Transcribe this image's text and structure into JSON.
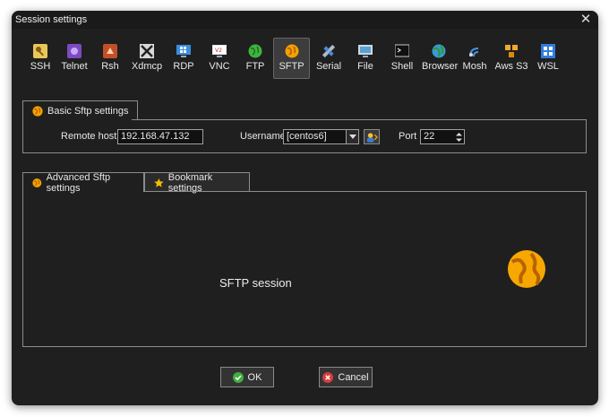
{
  "window": {
    "title": "Session settings"
  },
  "toolbar": {
    "items": [
      {
        "id": "ssh",
        "label": "SSH",
        "icon": "key-icon"
      },
      {
        "id": "telnet",
        "label": "Telnet",
        "icon": "telnet-icon"
      },
      {
        "id": "rsh",
        "label": "Rsh",
        "icon": "rsh-icon"
      },
      {
        "id": "xdmcp",
        "label": "Xdmcp",
        "icon": "x-logo-icon"
      },
      {
        "id": "rdp",
        "label": "RDP",
        "icon": "windows-monitor-icon"
      },
      {
        "id": "vnc",
        "label": "VNC",
        "icon": "vnc-monitor-icon"
      },
      {
        "id": "ftp",
        "label": "FTP",
        "icon": "green-globe-icon"
      },
      {
        "id": "sftp",
        "label": "SFTP",
        "icon": "orange-globe-icon",
        "active": true
      },
      {
        "id": "serial",
        "label": "Serial",
        "icon": "satellite-icon"
      },
      {
        "id": "file",
        "label": "File",
        "icon": "monitor-icon"
      },
      {
        "id": "shell",
        "label": "Shell",
        "icon": "terminal-icon"
      },
      {
        "id": "browser",
        "label": "Browser",
        "icon": "globe-icon"
      },
      {
        "id": "mosh",
        "label": "Mosh",
        "icon": "antenna-icon"
      },
      {
        "id": "awss3",
        "label": "Aws S3",
        "icon": "cubes-icon"
      },
      {
        "id": "wsl",
        "label": "WSL",
        "icon": "windows-logo-icon"
      }
    ]
  },
  "basic": {
    "tab_label": "Basic Sftp settings",
    "remote_host_label": "Remote host *",
    "remote_host_value": "192.168.47.132",
    "username_label": "Username",
    "username_value": "[centos6]",
    "port_label": "Port",
    "port_value": "22"
  },
  "advanced": {
    "tabs": [
      {
        "label": "Advanced Sftp settings",
        "icon": "orange-globe-icon",
        "active": true
      },
      {
        "label": "Bookmark settings",
        "icon": "star-icon",
        "active": false
      }
    ],
    "session_text": "SFTP session"
  },
  "buttons": {
    "ok_label": "OK",
    "cancel_label": "Cancel"
  },
  "colors": {
    "accent_orange": "#f0a000",
    "ok_green": "#3fae3f",
    "cancel_red": "#d83b3b",
    "window_bg": "#1f1f1f"
  }
}
